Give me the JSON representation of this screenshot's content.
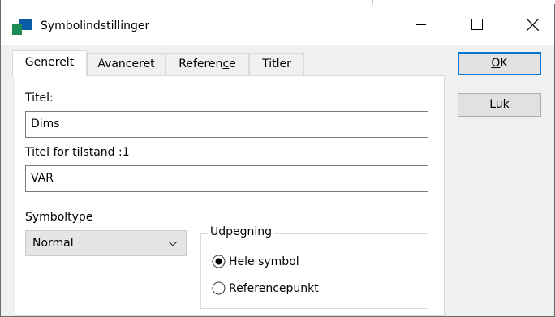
{
  "window": {
    "title": "Symbolindstillinger"
  },
  "tabs": [
    {
      "label": "Generelt",
      "active": true
    },
    {
      "label": "Avanceret",
      "active": false
    },
    {
      "label_pre": "Referen",
      "label_mnemonic": "c",
      "label_post": "e",
      "active": false
    },
    {
      "label": "Titler",
      "active": false
    }
  ],
  "general": {
    "title_label": "Titel:",
    "title_value": "Dims",
    "state_title_label": "Titel for tilstand :1",
    "state_title_value": "VAR",
    "symboltype_label": "Symboltype",
    "symboltype_selected": "Normal",
    "selection_group": {
      "legend": "Udpegning",
      "options": [
        {
          "label": "Hele symbol",
          "checked": true
        },
        {
          "label": "Referencepunkt",
          "checked": false
        }
      ]
    }
  },
  "buttons": {
    "ok_mnemonic": "O",
    "ok_rest": "K",
    "close_mnemonic": "L",
    "close_rest": "uk"
  },
  "colors": {
    "accent": "#0078d7",
    "icon_green": "#1e8a56",
    "icon_blue": "#0a5ea8"
  }
}
